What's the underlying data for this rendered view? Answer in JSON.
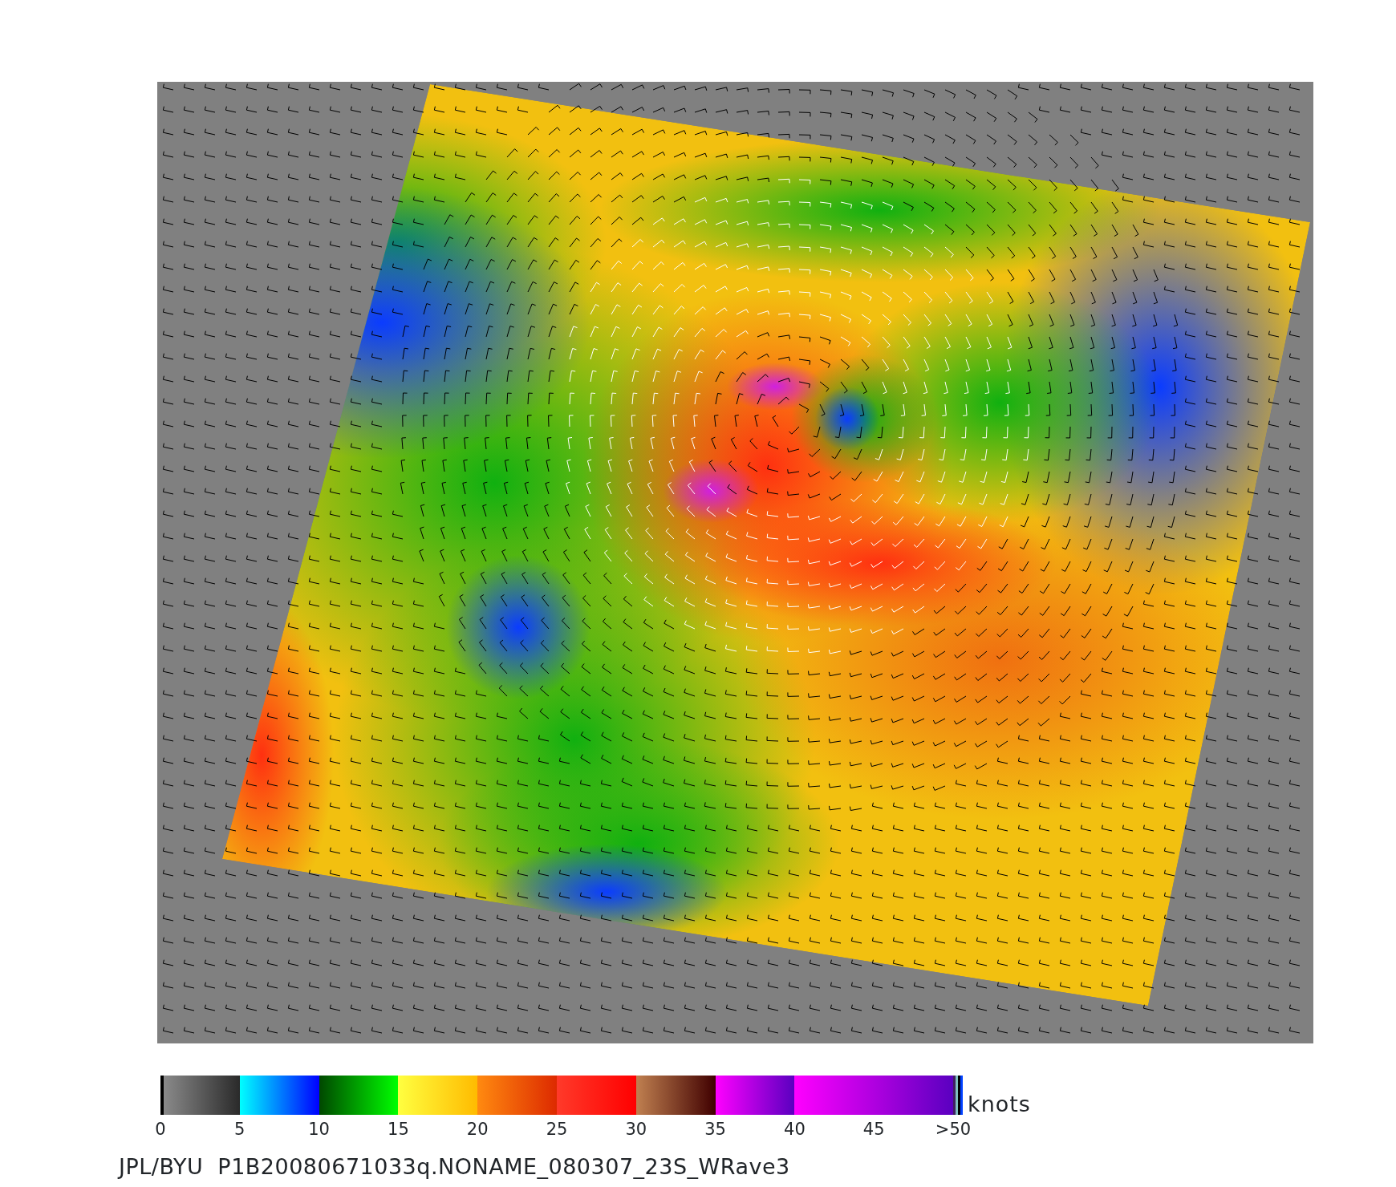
{
  "colorbar": {
    "ticks": [
      "0",
      "5",
      "10",
      "15",
      "20",
      "25",
      "30",
      "35",
      "40",
      "45",
      ">50"
    ],
    "unit": "knots"
  },
  "caption": "JPL/BYU  P1B20080671033q.NONAME_080307_23S_WRave3"
}
